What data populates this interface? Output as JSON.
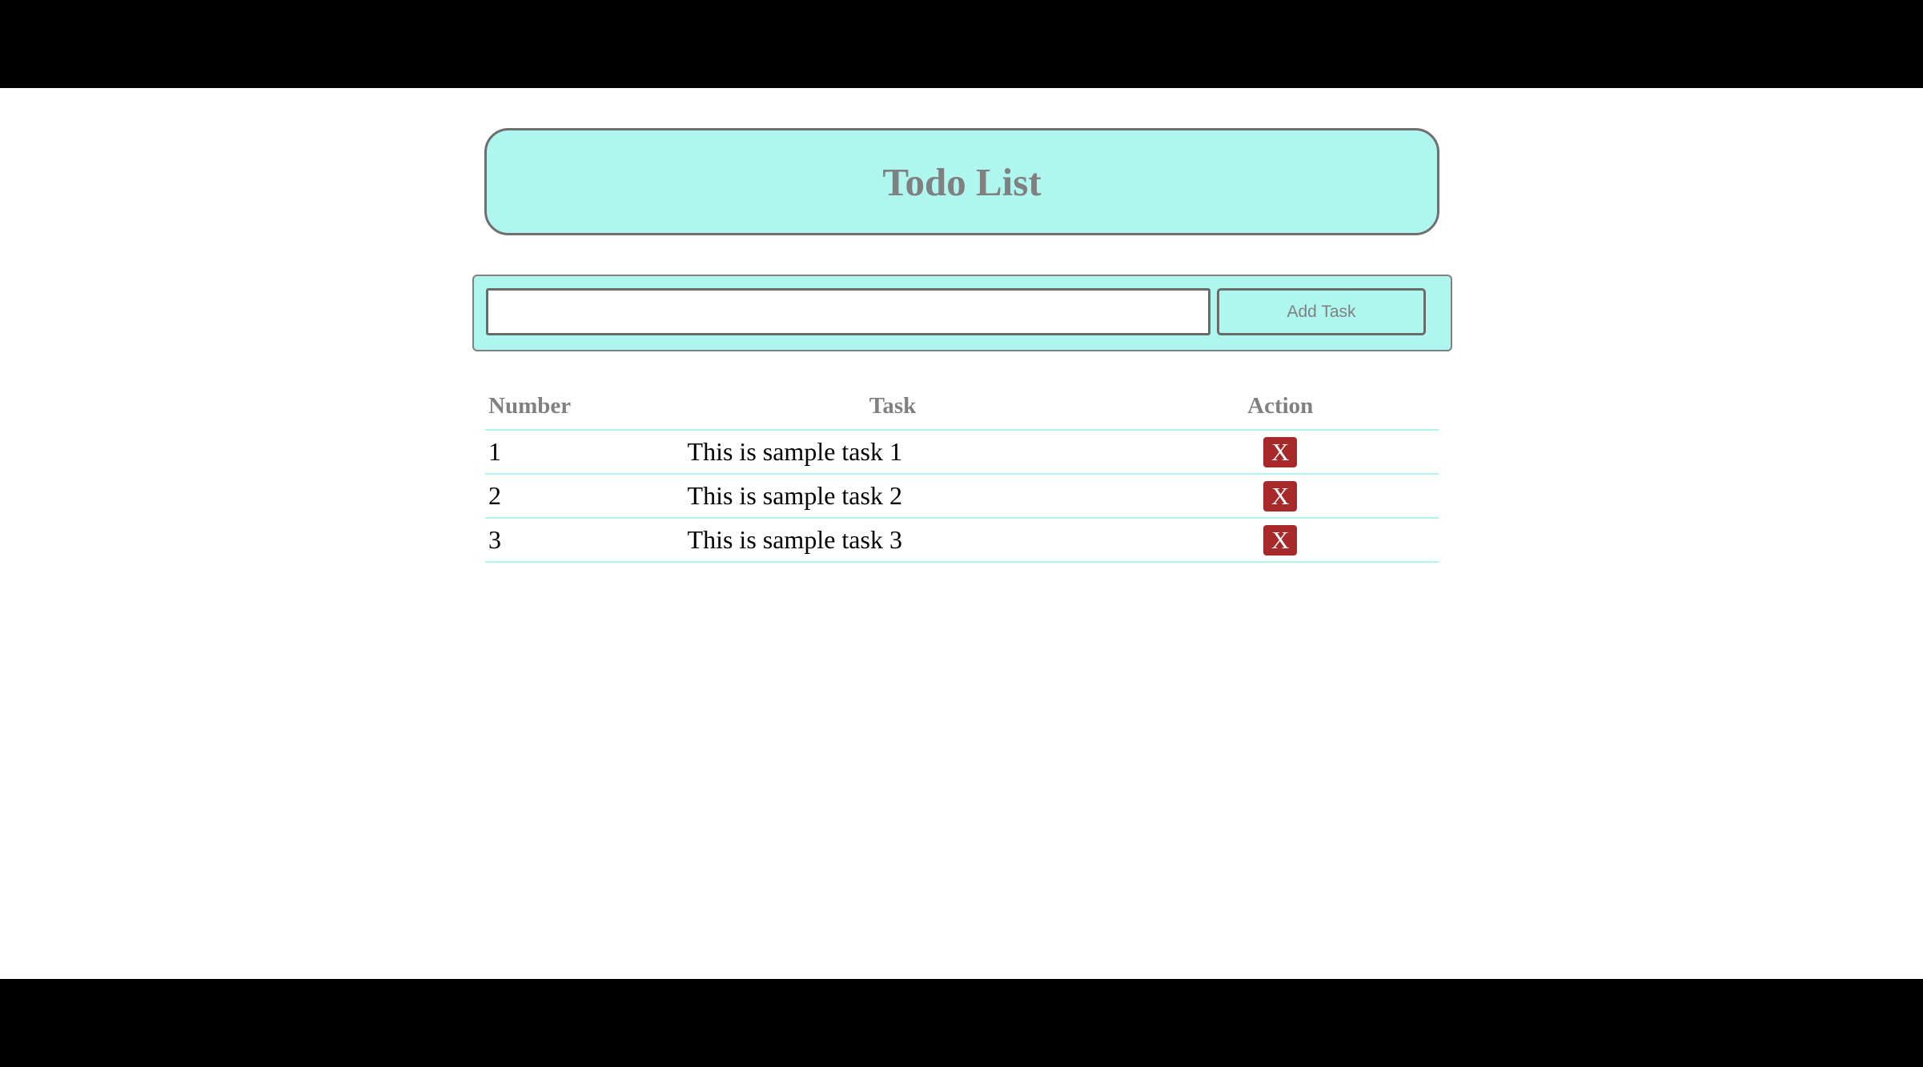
{
  "header": {
    "title": "Todo List"
  },
  "add_bar": {
    "input_value": "",
    "input_placeholder": "",
    "add_button_label": "Add Task"
  },
  "table": {
    "headers": {
      "number": "Number",
      "task": "Task",
      "action": "Action"
    },
    "rows": [
      {
        "number": "1",
        "task": "This is sample task 1",
        "action_label": "X"
      },
      {
        "number": "2",
        "task": "This is sample task 2",
        "action_label": "X"
      },
      {
        "number": "3",
        "task": "This is sample task 3",
        "action_label": "X"
      }
    ]
  },
  "colors": {
    "accent": "#aff6ef",
    "delete": "#a72929",
    "heading_text": "#808080",
    "letterbox": "#000000"
  }
}
